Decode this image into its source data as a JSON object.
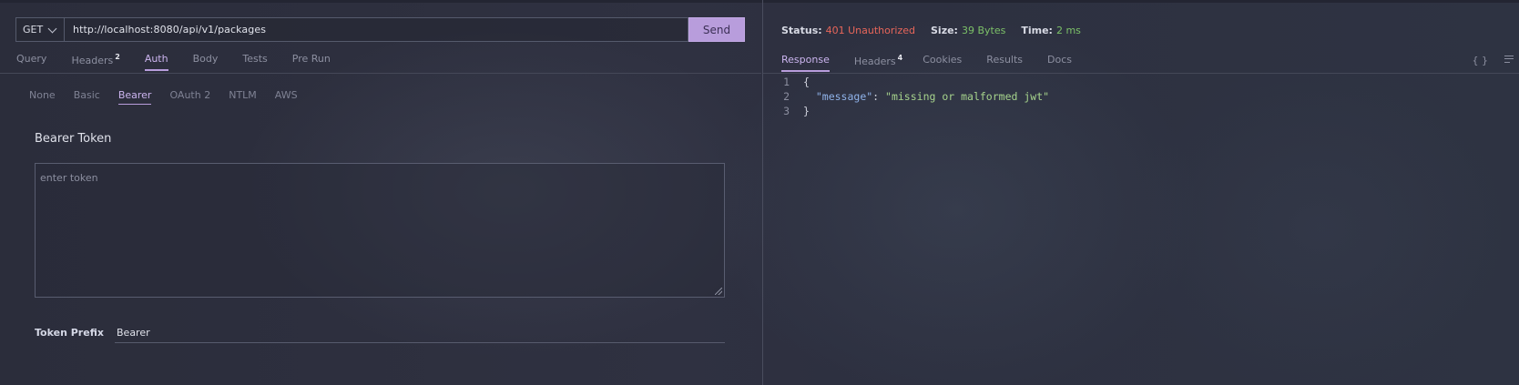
{
  "request": {
    "method": "GET",
    "url": "http://localhost:8080/api/v1/packages",
    "send_label": "Send"
  },
  "request_tabs": [
    {
      "label": "Query",
      "badge": ""
    },
    {
      "label": "Headers",
      "badge": "2"
    },
    {
      "label": "Auth",
      "badge": ""
    },
    {
      "label": "Body",
      "badge": ""
    },
    {
      "label": "Tests",
      "badge": ""
    },
    {
      "label": "Pre Run",
      "badge": ""
    }
  ],
  "auth_tabs": [
    "None",
    "Basic",
    "Bearer",
    "OAuth 2",
    "NTLM",
    "AWS"
  ],
  "auth": {
    "section_title": "Bearer Token",
    "token_placeholder": "enter token",
    "prefix_label": "Token Prefix",
    "prefix_value": "Bearer"
  },
  "response_status": {
    "status_label": "Status:",
    "status_value": "401 Unauthorized",
    "size_label": "Size:",
    "size_value": "39 Bytes",
    "time_label": "Time:",
    "time_value": "2 ms",
    "colors": {
      "error": "#e8665a",
      "ok": "#7cc168",
      "accent": "#b89ddc"
    }
  },
  "response_tabs": [
    {
      "label": "Response",
      "badge": ""
    },
    {
      "label": "Headers",
      "badge": "4"
    },
    {
      "label": "Cookies",
      "badge": ""
    },
    {
      "label": "Results",
      "badge": ""
    },
    {
      "label": "Docs",
      "badge": ""
    }
  ],
  "response_icons": {
    "braces": "{ }",
    "wrap": "wrap-lines-icon"
  },
  "response_body": {
    "line_numbers": [
      "1",
      "2",
      "3"
    ],
    "open": "{",
    "key": "\"message\"",
    "colon": ": ",
    "value": "\"missing or malformed jwt\"",
    "close": "}"
  }
}
